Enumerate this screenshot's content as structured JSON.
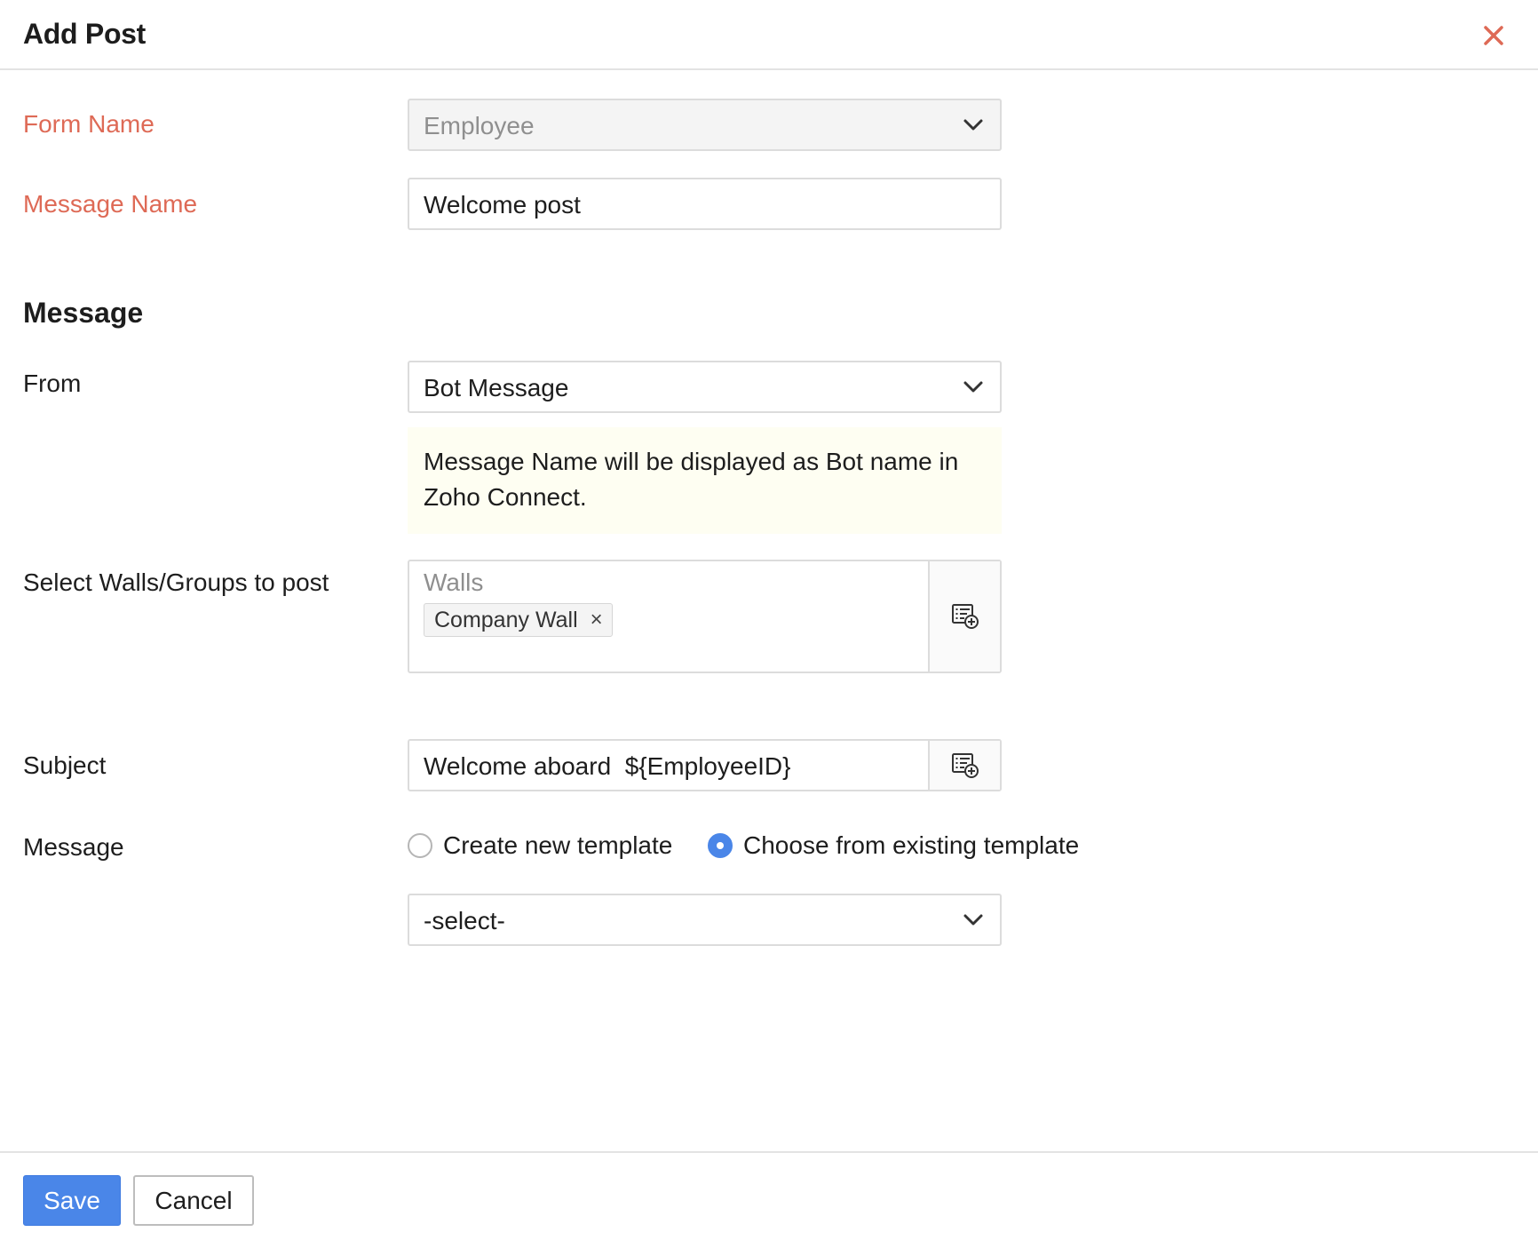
{
  "dialog": {
    "title": "Add Post"
  },
  "form_name": {
    "label": "Form Name",
    "value": "Employee"
  },
  "message_name": {
    "label": "Message Name",
    "value": "Welcome post"
  },
  "message_section": {
    "title": "Message"
  },
  "from": {
    "label": "From",
    "value": "Bot Message",
    "info": "Message Name will be displayed as Bot name in Zoho Connect."
  },
  "walls": {
    "label": "Select Walls/Groups to post",
    "caption": "Walls",
    "chips": [
      "Company Wall"
    ],
    "chip_remove": "×"
  },
  "subject": {
    "label": "Subject",
    "value": "Welcome aboard  ${EmployeeID}"
  },
  "message_option": {
    "label": "Message",
    "options": [
      "Create new template",
      "Choose from existing template"
    ],
    "selected": "Choose from existing template",
    "template_select": "-select-"
  },
  "footer": {
    "save_label": "Save",
    "cancel_label": "Cancel"
  },
  "colors": {
    "required_label": "#de6a56",
    "primary": "#4a86e8",
    "info_bg": "#fefef2"
  },
  "icons": {
    "close": "close-icon",
    "dropdown": "chevron-down-icon",
    "merge_field": "insert-field-icon"
  }
}
